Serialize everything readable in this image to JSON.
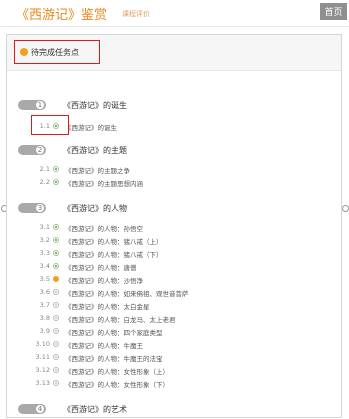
{
  "header": {
    "title": "《西游记》鉴赏",
    "subtitle": "课程评价",
    "home_label": "首页"
  },
  "panel": {
    "task_label": "待完成任务点"
  },
  "chapters": [
    {
      "num": "1",
      "title": "《西游记》的诞生",
      "lessons": [
        {
          "num": "1.1",
          "title": "《西游记》的诞生",
          "status": "done"
        }
      ]
    },
    {
      "num": "2",
      "title": "《西游记》的主题",
      "lessons": [
        {
          "num": "2.1",
          "title": "《西游记》的主题之争",
          "status": "done"
        },
        {
          "num": "2.2",
          "title": "《西游记》的主题思想内涵",
          "status": "done"
        }
      ]
    },
    {
      "num": "3",
      "title": "《西游记》的人物",
      "lessons": [
        {
          "num": "3.1",
          "title": "《西游记》的人物：孙悟空",
          "status": "done"
        },
        {
          "num": "3.2",
          "title": "《西游记》的人物：猪八戒（上）",
          "status": "done"
        },
        {
          "num": "3.3",
          "title": "《西游记》的人物：猪八戒（下）",
          "status": "done"
        },
        {
          "num": "3.4",
          "title": "《西游记》的人物：唐僧",
          "status": "done"
        },
        {
          "num": "3.5",
          "title": "《西游记》的人物：沙悟净",
          "status": "current"
        },
        {
          "num": "3.6",
          "title": "《西游记》的人物：如来佛祖、观世音菩萨",
          "status": "locked"
        },
        {
          "num": "3.7",
          "title": "《西游记》的人物：太白金星",
          "status": "locked"
        },
        {
          "num": "3.8",
          "title": "《西游记》的人物：白龙马、太上老君",
          "status": "locked"
        },
        {
          "num": "3.9",
          "title": "《西游记》的人物：四个家庭类型",
          "status": "locked"
        },
        {
          "num": "3.10",
          "title": "《西游记》的人物：牛魔王",
          "status": "locked"
        },
        {
          "num": "3.11",
          "title": "《西游记》的人物：牛魔王的法宝",
          "status": "locked"
        },
        {
          "num": "3.12",
          "title": "《西游记》的人物：女性形象（上）",
          "status": "locked"
        },
        {
          "num": "3.13",
          "title": "《西游记》的人物：女性形象（下）",
          "status": "locked"
        }
      ]
    },
    {
      "num": "4",
      "title": "《西游记》的艺术",
      "lessons": []
    }
  ],
  "colors": {
    "accent": "#e8891a",
    "highlight_border": "#e21a1a",
    "done": "#4f9a2e",
    "current": "#f2a01c",
    "locked": "#c2c2c2"
  }
}
